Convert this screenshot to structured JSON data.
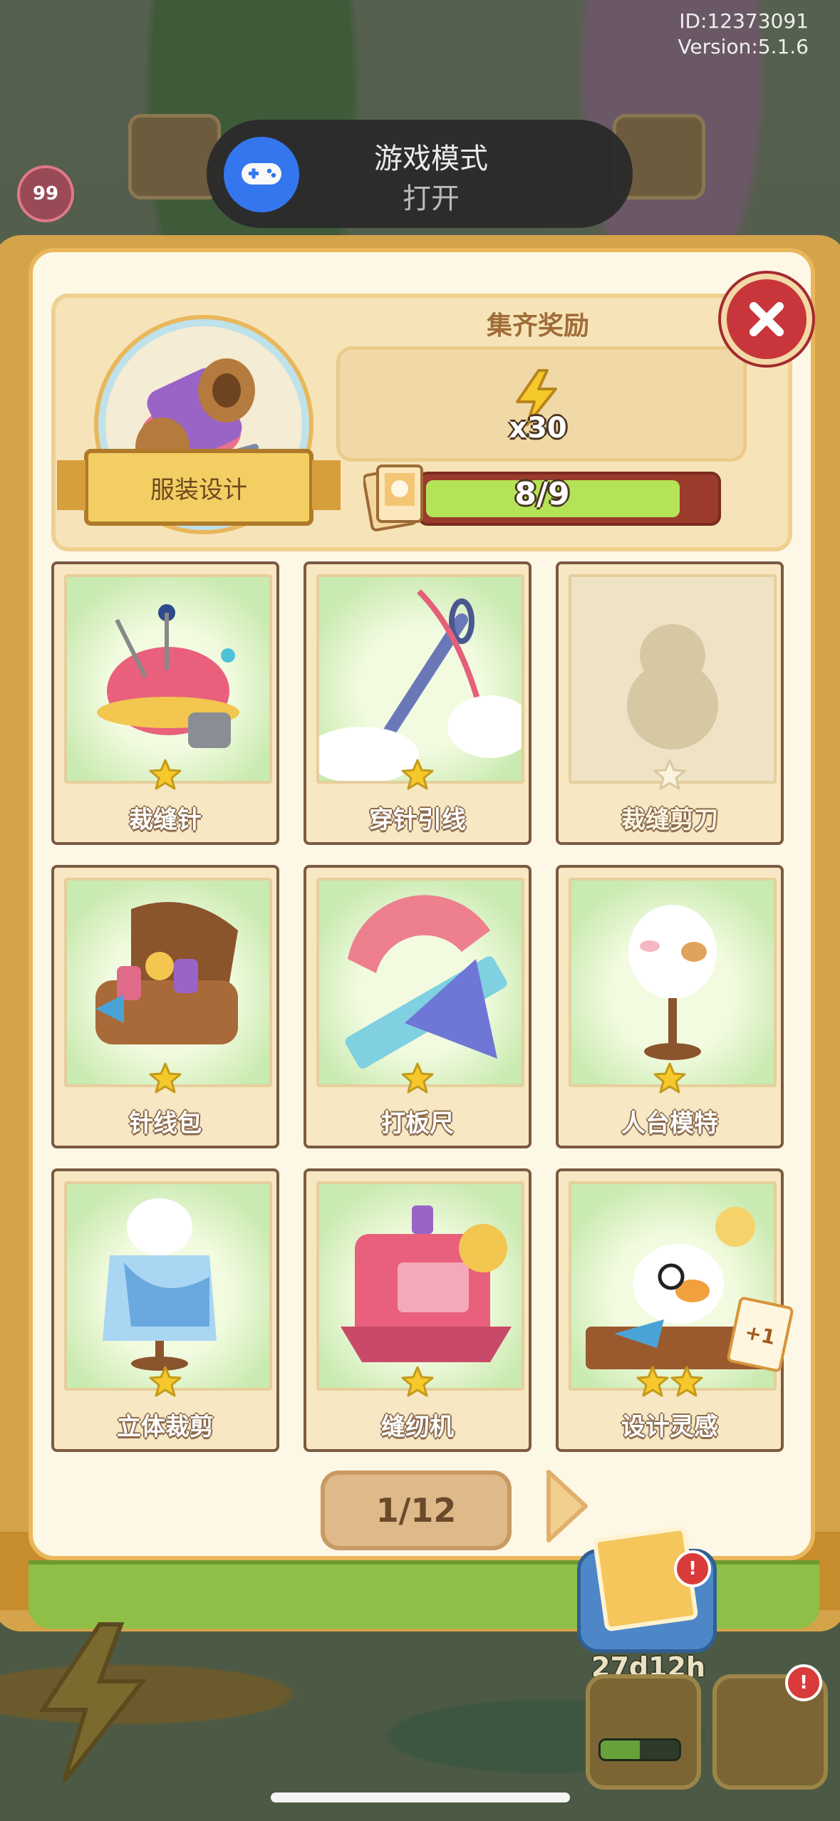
{
  "status": {
    "user_id": "ID:12373091",
    "version": "Version:5.1.6",
    "level": "99"
  },
  "toast": {
    "title": "游戏模式",
    "subtitle": "打开",
    "icon": "gamepad-icon"
  },
  "collection": {
    "set_name": "服装设计",
    "reward_title": "集齐奖励",
    "reward_amount": "x30",
    "reward_icon": "lightning-icon",
    "progress_text": "8/9",
    "progress_fraction": 0.889
  },
  "cards": [
    {
      "name": "裁缝针",
      "stars": 1,
      "locked": false,
      "icon": "pin-cushion-icon"
    },
    {
      "name": "穿针引线",
      "stars": 1,
      "locked": false,
      "icon": "needle-thread-icon"
    },
    {
      "name": "裁缝剪刀",
      "stars": 1,
      "locked": true,
      "icon": "duck-silhouette-icon"
    },
    {
      "name": "针线包",
      "stars": 1,
      "locked": false,
      "icon": "sewing-box-icon"
    },
    {
      "name": "打板尺",
      "stars": 1,
      "locked": false,
      "icon": "ruler-set-icon"
    },
    {
      "name": "人台模特",
      "stars": 1,
      "locked": false,
      "icon": "mannequin-icon"
    },
    {
      "name": "立体裁剪",
      "stars": 1,
      "locked": false,
      "icon": "draping-mannequin-icon"
    },
    {
      "name": "缝纫机",
      "stars": 1,
      "locked": false,
      "icon": "sewing-machine-icon"
    },
    {
      "name": "设计灵感",
      "stars": 2,
      "locked": false,
      "icon": "duck-designer-icon"
    }
  ],
  "extra_badge": "+1",
  "pager": {
    "text": "1/12"
  },
  "bottom_hud": {
    "timer": "27d12h",
    "alert": "!",
    "timer_progress": 0.5
  },
  "colors": {
    "close_red": "#c8363b",
    "progress_green": "#b4e357",
    "page_cream": "#fdf7e6",
    "frame_gold": "#d4a34a",
    "star_yellow": "#f5c82c"
  }
}
